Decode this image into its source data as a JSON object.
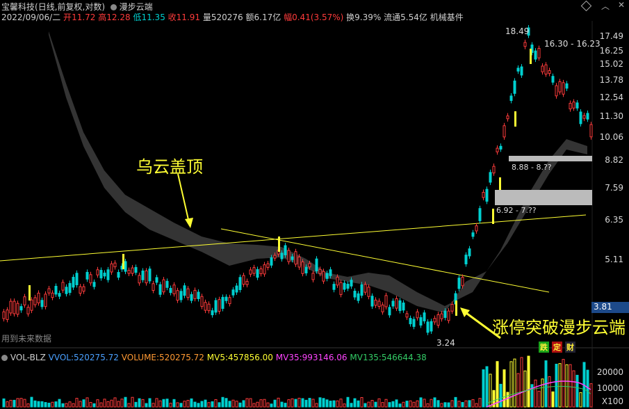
{
  "header": {
    "stock_name": "宝馨科技",
    "period_info": "(日线,前复权,对数)",
    "indicator_name": "漫步云端",
    "date": "2022/09/06/二",
    "open_label": "开",
    "open": "11.72",
    "high_label": "高",
    "high": "12.28",
    "low_label": "低",
    "low": "11.35",
    "close_label": "收",
    "close": "11.91",
    "volume_label": "量",
    "volume": "520276",
    "amount_label": "额",
    "amount": "6.17亿",
    "change_label": "幅",
    "change": "0.41(3.57%)",
    "turnover_label": "换",
    "turnover": "9.39%",
    "float_label": "流通",
    "float": "5.54亿",
    "sector": "机械基件"
  },
  "price_axis": [
    "17.49",
    "16.25",
    "15.02",
    "13.78",
    "12.54",
    "11.30",
    "10.06",
    "8.82",
    "7.59",
    "6.35",
    "5.11"
  ],
  "current_price": "3.81",
  "annotations": {
    "dark_cloud": "乌云盖顶",
    "limit_up_break": "涨停突破漫步云端"
  },
  "price_marks": {
    "high_mark": "18.49",
    "low_mark": "3.24",
    "range_1": "16.30 - 16.23",
    "range_2": "8.88 - 8.??",
    "range_3": "6.92 - 7.??"
  },
  "future_data": "用到未来数据",
  "corner_tags": [
    "跌",
    "定",
    "财"
  ],
  "volume_panel": {
    "name": "VOL-BLZ",
    "vvol_label": "VVOL:",
    "vvol": "520275.72",
    "volume_label": "VOLUME:",
    "volume": "520275.72",
    "mv5_label": "MV5:",
    "mv5": "457856.00",
    "mv35_label": "MV35:",
    "mv35": "993146.06",
    "mv135_label": "MV135:",
    "mv135": "546644.38",
    "axis": [
      "20000",
      "10000"
    ],
    "unit": "X100"
  },
  "colors": {
    "up": "#ff3b3b",
    "down": "#00d0d0",
    "yellow": "#ffff33",
    "cloud": "#3a3a3a",
    "mv35": "#ff44ff"
  }
}
